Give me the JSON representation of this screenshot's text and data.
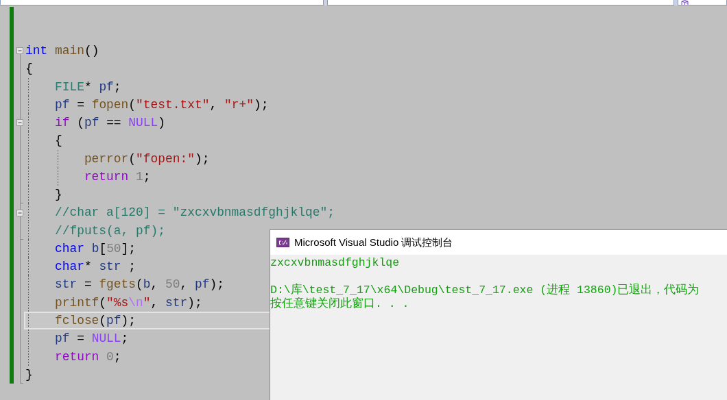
{
  "code": {
    "lines": [
      {
        "tokens": [
          {
            "text": "int ",
            "kind": "keyword"
          },
          {
            "text": "main",
            "kind": "function"
          },
          {
            "text": "()",
            "kind": "punct"
          }
        ],
        "expanded": true,
        "current": false,
        "children": [
          {
            "tokens": [
              {
                "text": "{",
                "kind": "open-brace"
              }
            ],
            "current": false
          },
          {
            "tokens": [
              {
                "text": "FILE",
                "kind": "type"
              },
              {
                "text": "* ",
                "kind": "punct"
              },
              {
                "text": "pf",
                "kind": "variable"
              },
              {
                "text": ";",
                "kind": "punct"
              }
            ],
            "current": false
          },
          {
            "tokens": [
              {
                "text": "pf",
                "kind": "variable"
              },
              {
                "text": " = ",
                "kind": "punct"
              },
              {
                "text": "fopen",
                "kind": "function"
              },
              {
                "text": "(",
                "kind": "punct"
              },
              {
                "text": "\"test.txt\"",
                "kind": "string"
              },
              {
                "text": ", ",
                "kind": "punct"
              },
              {
                "text": "\"r+\"",
                "kind": "string"
              },
              {
                "text": ");",
                "kind": "punct"
              }
            ],
            "current": false
          },
          {
            "tokens": [
              {
                "text": "if",
                "kind": "control"
              },
              {
                "text": " (",
                "kind": "punct"
              },
              {
                "text": "pf",
                "kind": "variable"
              },
              {
                "text": " == ",
                "kind": "punct"
              },
              {
                "text": "NULL",
                "kind": "macro"
              },
              {
                "text": ")",
                "kind": "punct"
              }
            ],
            "expanded": true,
            "current": false,
            "children": [
              {
                "tokens": [
                  {
                    "text": "{",
                    "kind": "open-brace"
                  }
                ],
                "current": false
              },
              {
                "tokens": [
                  {
                    "text": "perror",
                    "kind": "function"
                  },
                  {
                    "text": "(",
                    "kind": "punct"
                  },
                  {
                    "text": "\"fopen:\"",
                    "kind": "string"
                  },
                  {
                    "text": ");",
                    "kind": "punct"
                  }
                ],
                "current": false
              },
              {
                "tokens": [
                  {
                    "text": "return ",
                    "kind": "control"
                  },
                  {
                    "text": "1",
                    "kind": "number"
                  },
                  {
                    "text": ";",
                    "kind": "punct"
                  }
                ],
                "current": false
              },
              {
                "tokens": [
                  {
                    "text": "}",
                    "kind": "close-brace"
                  }
                ],
                "current": false
              }
            ]
          },
          {
            "tokens": [
              {
                "text": "//char a[120] = \"zxcxvbnmasdfghjklqe\";",
                "kind": "comment"
              }
            ],
            "expanded": true,
            "current": false,
            "children": [
              {
                "tokens": [
                  {
                    "text": "//fputs(a, pf);",
                    "kind": "comment"
                  }
                ],
                "current": false
              }
            ]
          },
          {
            "tokens": [
              {
                "text": "char ",
                "kind": "keyword"
              },
              {
                "text": "b",
                "kind": "variable"
              },
              {
                "text": "[",
                "kind": "punct"
              },
              {
                "text": "50",
                "kind": "number"
              },
              {
                "text": "];",
                "kind": "punct"
              }
            ],
            "current": false
          },
          {
            "tokens": [
              {
                "text": "char",
                "kind": "keyword"
              },
              {
                "text": "* ",
                "kind": "punct"
              },
              {
                "text": "str",
                "kind": "variable"
              },
              {
                "text": " ;",
                "kind": "punct"
              }
            ],
            "current": false
          },
          {
            "tokens": [
              {
                "text": "str",
                "kind": "variable"
              },
              {
                "text": " = ",
                "kind": "punct"
              },
              {
                "text": "fgets",
                "kind": "function"
              },
              {
                "text": "(",
                "kind": "punct"
              },
              {
                "text": "b",
                "kind": "variable"
              },
              {
                "text": ", ",
                "kind": "punct"
              },
              {
                "text": "50",
                "kind": "number"
              },
              {
                "text": ", ",
                "kind": "punct"
              },
              {
                "text": "pf",
                "kind": "variable"
              },
              {
                "text": ");",
                "kind": "punct"
              }
            ],
            "current": false
          },
          {
            "tokens": [
              {
                "text": "printf",
                "kind": "function"
              },
              {
                "text": "(",
                "kind": "punct"
              },
              {
                "text": "\"%s",
                "kind": "string"
              },
              {
                "text": "\\n",
                "kind": "escape"
              },
              {
                "text": "\"",
                "kind": "string"
              },
              {
                "text": ", ",
                "kind": "punct"
              },
              {
                "text": "str",
                "kind": "variable"
              },
              {
                "text": ");",
                "kind": "punct"
              }
            ],
            "current": false
          },
          {
            "tokens": [
              {
                "text": "fclose",
                "kind": "function"
              },
              {
                "text": "(",
                "kind": "punct"
              },
              {
                "text": "pf",
                "kind": "variable"
              },
              {
                "text": ");",
                "kind": "punct"
              }
            ],
            "current": true
          },
          {
            "tokens": [
              {
                "text": "pf",
                "kind": "variable"
              },
              {
                "text": " = ",
                "kind": "punct"
              },
              {
                "text": "NULL",
                "kind": "macro"
              },
              {
                "text": ";",
                "kind": "punct"
              }
            ],
            "current": false
          },
          {
            "tokens": [
              {
                "text": "return ",
                "kind": "control"
              },
              {
                "text": "0",
                "kind": "number"
              },
              {
                "text": ";",
                "kind": "punct"
              }
            ],
            "current": false
          },
          {
            "tokens": [
              {
                "text": "}",
                "kind": "close-brace"
              }
            ],
            "current": false
          }
        ]
      }
    ]
  },
  "console": {
    "title": "Microsoft Visual Studio 调试控制台",
    "output": [
      [
        "zxcxvbnmasdfghjklqe"
      ],
      [
        "D:\\库\\test_7_17\\x64\\Debug\\test_7_17.exe (进程 13860)已退出，代码为",
        "按任意键关闭此窗口. . ."
      ]
    ]
  }
}
